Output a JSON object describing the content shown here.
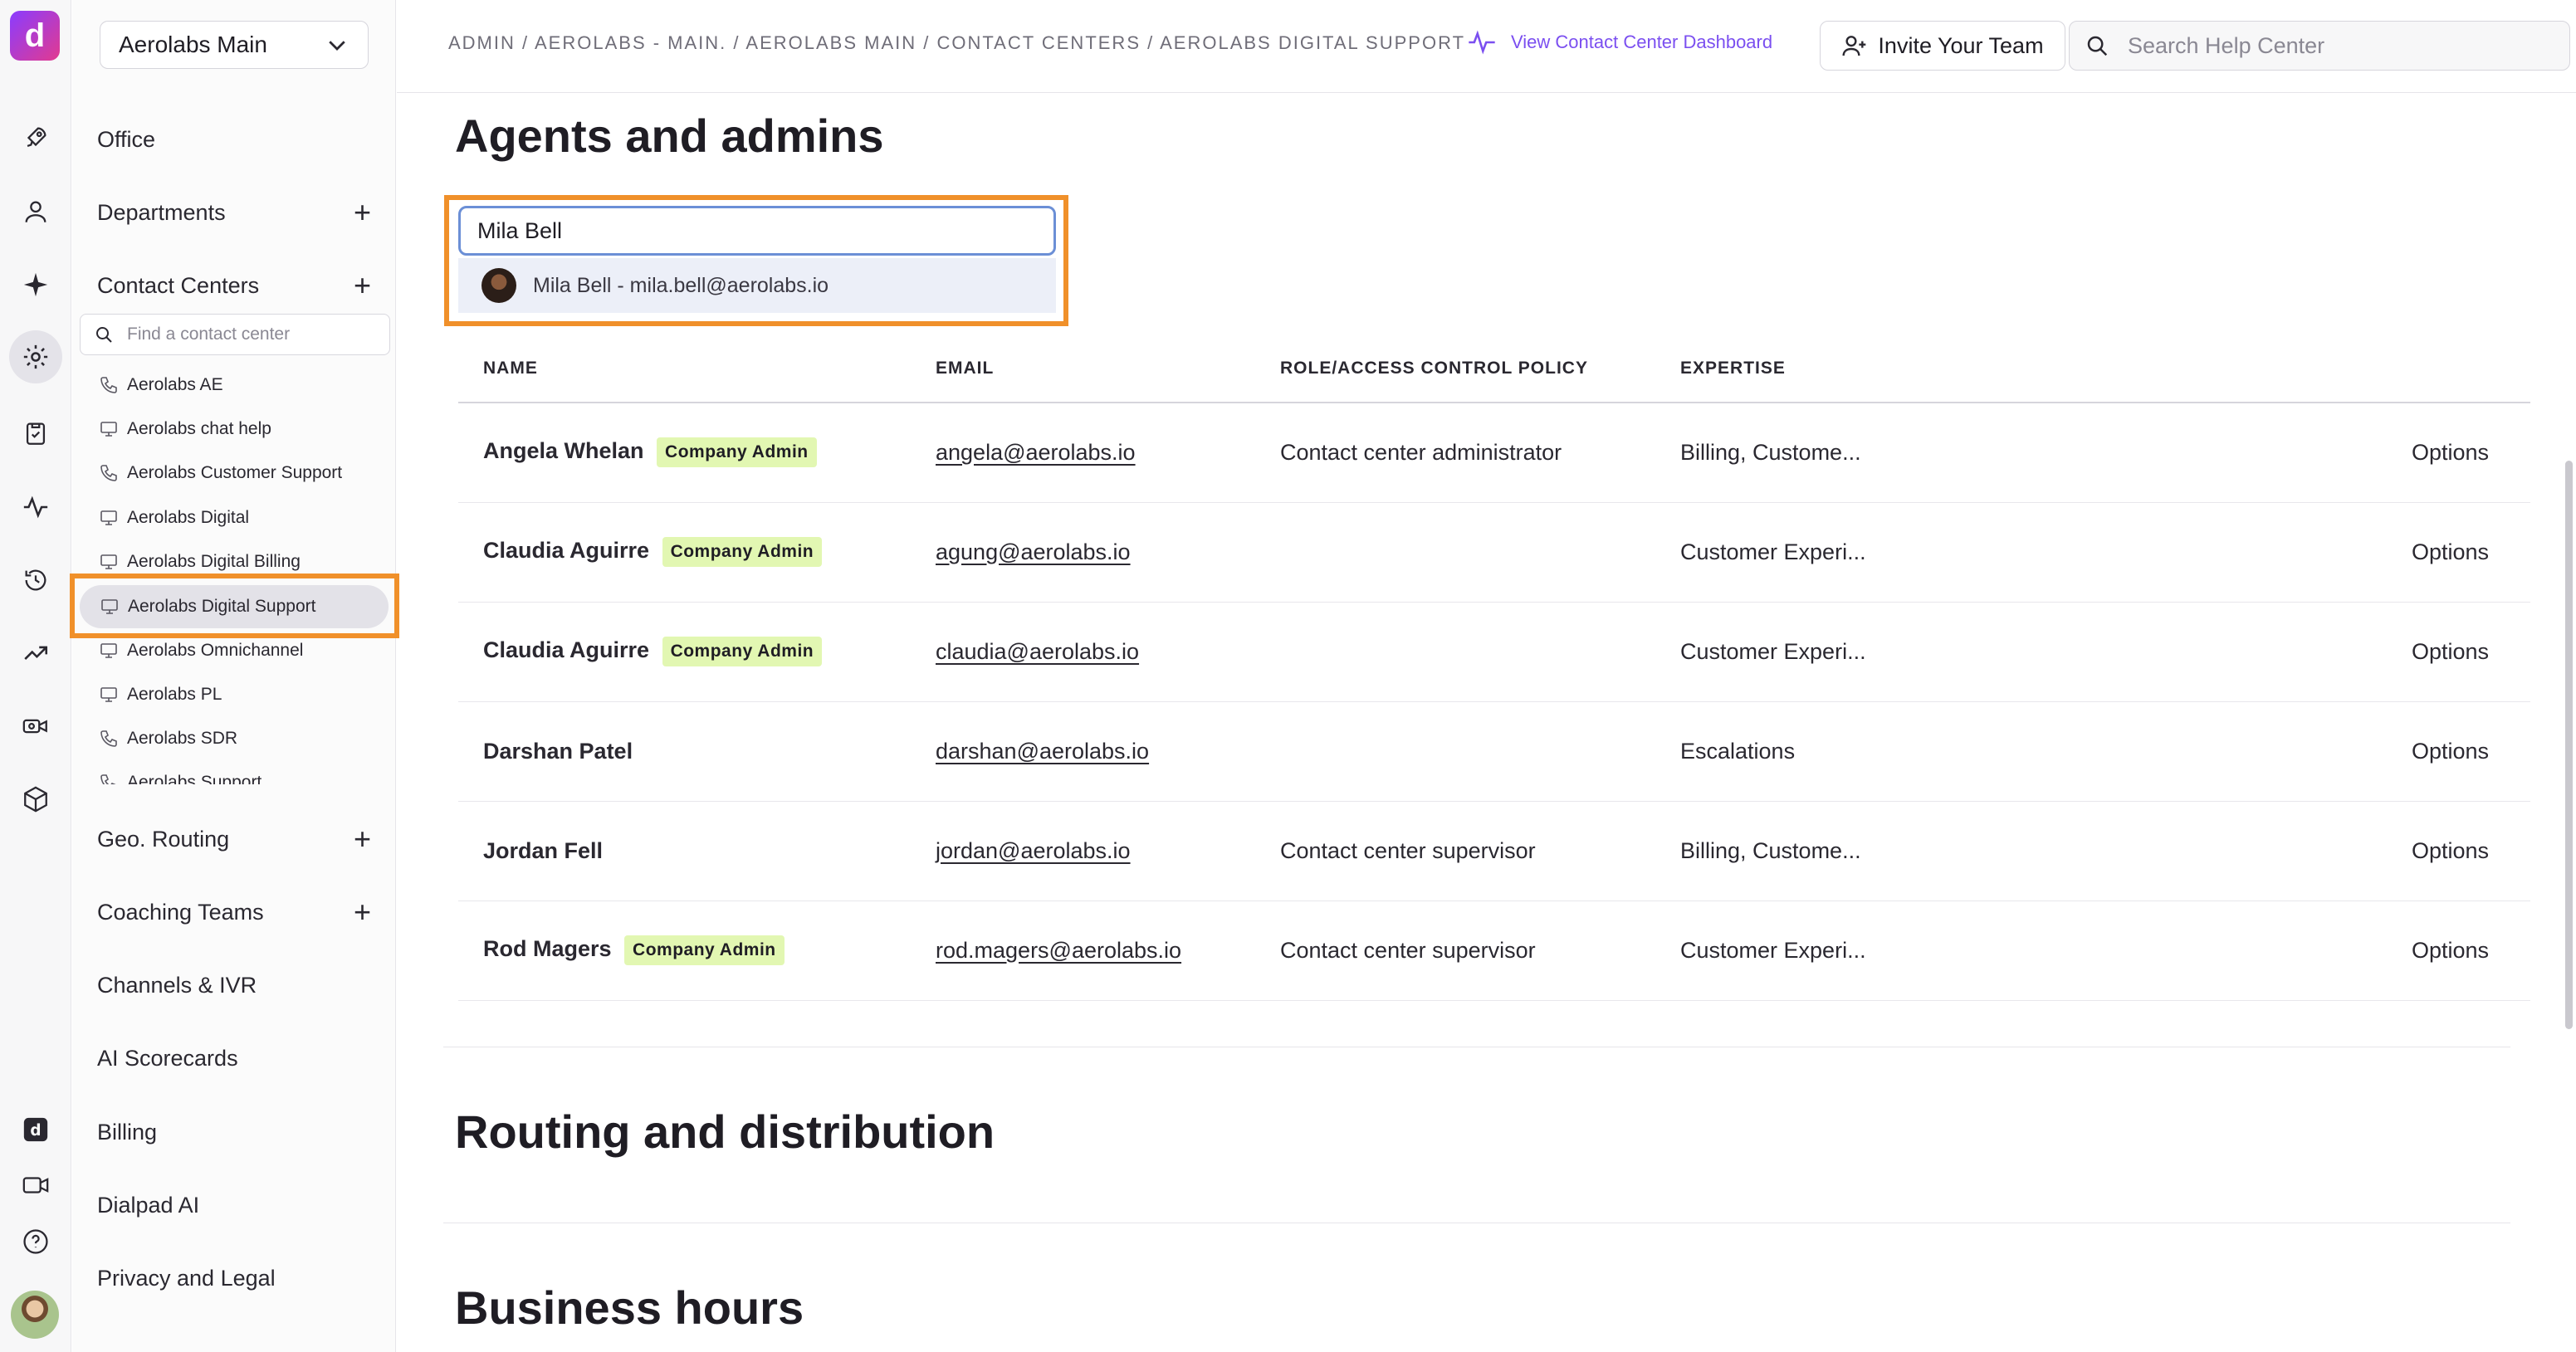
{
  "rail": {
    "logo_letter": "d",
    "icons": [
      "rocket-icon",
      "user-icon",
      "sparkle-icon",
      "gear-icon",
      "clipboard-icon",
      "pulse-icon",
      "history-icon",
      "trend-icon",
      "video-settings-icon",
      "box-icon",
      "dialpad-app-icon",
      "video-icon",
      "help-icon"
    ]
  },
  "nav": {
    "workspace": "Aerolabs Main",
    "items": {
      "office": "Office",
      "departments": "Departments",
      "contact_centers": "Contact Centers",
      "geo_routing": "Geo. Routing",
      "coaching_teams": "Coaching Teams",
      "channels_ivr": "Channels & IVR",
      "ai_scorecards": "AI Scorecards",
      "billing": "Billing",
      "dialpad_ai": "Dialpad AI",
      "privacy_legal": "Privacy and Legal"
    },
    "cc_search_placeholder": "Find a contact center",
    "contact_centers": [
      {
        "label": "Aerolabs AE",
        "icon": "phone"
      },
      {
        "label": "Aerolabs chat help",
        "icon": "monitor"
      },
      {
        "label": "Aerolabs Customer Support",
        "icon": "phone"
      },
      {
        "label": "Aerolabs Digital",
        "icon": "monitor"
      },
      {
        "label": "Aerolabs Digital Billing",
        "icon": "monitor"
      },
      {
        "label": "Aerolabs Digital Support",
        "icon": "monitor"
      },
      {
        "label": "Aerolabs Omnichannel",
        "icon": "monitor"
      },
      {
        "label": "Aerolabs PL",
        "icon": "monitor"
      },
      {
        "label": "Aerolabs SDR",
        "icon": "phone"
      },
      {
        "label": "Aerolabs Support",
        "icon": "phone"
      }
    ],
    "selected_contact_center": "Aerolabs Digital Support"
  },
  "topbar": {
    "breadcrumb": "ADMIN / AEROLABS - MAIN. / AEROLABS MAIN / CONTACT CENTERS / AEROLABS DIGITAL SUPPORT",
    "dashboard_link": "View Contact Center Dashboard",
    "invite_label": "Invite Your Team",
    "help_search_placeholder": "Search Help Center"
  },
  "main": {
    "agents_title": "Agents and admins",
    "agent_search_value": "Mila Bell",
    "suggestion": "Mila Bell - mila.bell@aerolabs.io",
    "columns": {
      "name": "NAME",
      "email": "EMAIL",
      "role": "ROLE/ACCESS CONTROL POLICY",
      "expertise": "EXPERTISE"
    },
    "rows": [
      {
        "name": "Angela Whelan",
        "badge": "Company Admin",
        "email": "angela@aerolabs.io",
        "role": "Contact center administrator",
        "expertise": "Billing, Custome...",
        "action": "Options"
      },
      {
        "name": "Claudia Aguirre",
        "badge": "Company Admin",
        "email": "agung@aerolabs.io",
        "role": "",
        "expertise": "Customer Experi...",
        "action": "Options"
      },
      {
        "name": "Claudia Aguirre",
        "badge": "Company Admin",
        "email": "claudia@aerolabs.io",
        "role": "",
        "expertise": "Customer Experi...",
        "action": "Options"
      },
      {
        "name": "Darshan Patel",
        "badge": "",
        "email": "darshan@aerolabs.io",
        "role": "",
        "expertise": "Escalations",
        "action": "Options"
      },
      {
        "name": "Jordan Fell",
        "badge": "",
        "email": "jordan@aerolabs.io",
        "role": "Contact center supervisor",
        "expertise": "Billing, Custome...",
        "action": "Options"
      },
      {
        "name": "Rod Magers",
        "badge": "Company Admin",
        "email": "rod.magers@aerolabs.io",
        "role": "Contact center supervisor",
        "expertise": "Customer Experi...",
        "action": "Options"
      }
    ],
    "routing_title": "Routing and distribution",
    "business_hours_title": "Business hours"
  },
  "colors": {
    "accent": "#7b4ff0",
    "highlight": "#f0902a",
    "badge_bg": "#e2f7b2"
  }
}
